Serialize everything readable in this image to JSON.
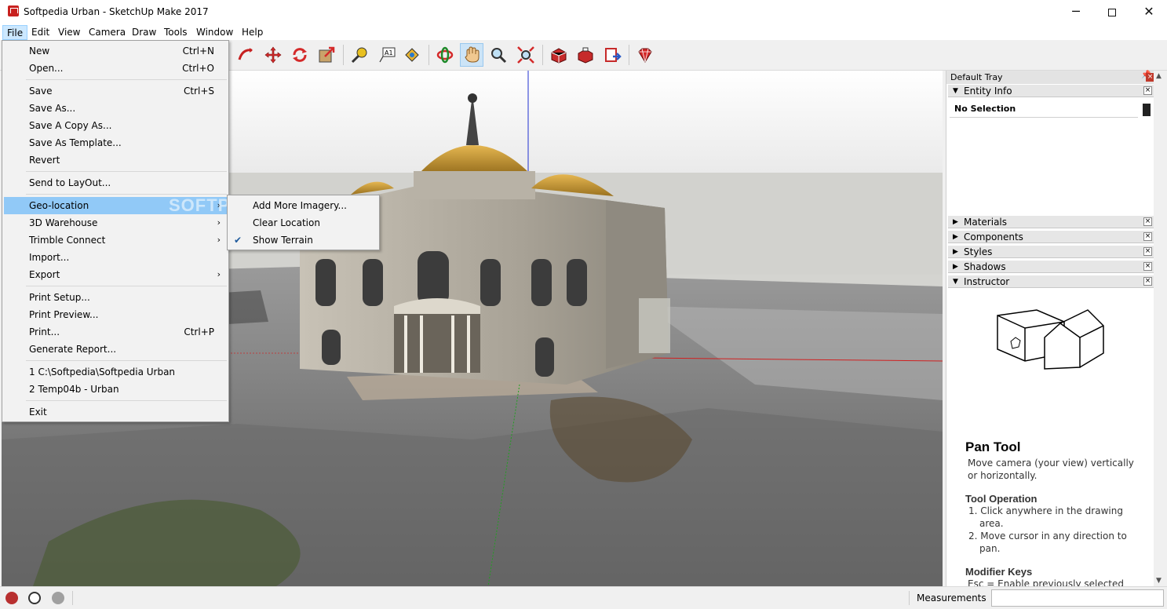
{
  "window": {
    "title": "Softpedia Urban - SketchUp Make 2017",
    "min_glyph": "─",
    "close_glyph": "✕"
  },
  "menubar": [
    {
      "label": "File",
      "active": true
    },
    {
      "label": "Edit"
    },
    {
      "label": "View"
    },
    {
      "label": "Camera"
    },
    {
      "label": "Draw"
    },
    {
      "label": "Tools"
    },
    {
      "label": "Window"
    },
    {
      "label": "Help"
    }
  ],
  "toolbar": {
    "icons": [
      "follow-me-icon",
      "move-icon",
      "rotate-icon",
      "scale-icon",
      "tape-measure-icon",
      "text-icon",
      "paint-bucket-icon",
      "orbit-icon",
      "pan-icon",
      "zoom-icon",
      "zoom-extents-icon",
      "3d-warehouse-icon",
      "share-model-icon",
      "send-to-layout-icon",
      "extension-warehouse-icon"
    ],
    "selected": "pan-icon",
    "text_tool_label": "A1"
  },
  "file_menu": {
    "items": [
      {
        "label": "New",
        "shortcut": "Ctrl+N"
      },
      {
        "label": "Open...",
        "shortcut": "Ctrl+O"
      },
      {
        "label": "Save",
        "shortcut": "Ctrl+S"
      },
      {
        "label": "Save As...",
        "shortcut": ""
      },
      {
        "label": "Save A Copy As...",
        "shortcut": ""
      },
      {
        "label": "Save As Template...",
        "shortcut": ""
      },
      {
        "label": "Revert",
        "shortcut": ""
      },
      {
        "label": "Send to LayOut...",
        "shortcut": ""
      },
      {
        "label": "Geo-location",
        "submenu": true,
        "highlighted": true
      },
      {
        "label": "3D Warehouse",
        "submenu": true
      },
      {
        "label": "Trimble Connect",
        "submenu": true
      },
      {
        "label": "Import...",
        "shortcut": ""
      },
      {
        "label": "Export",
        "submenu": true
      },
      {
        "label": "Print Setup...",
        "shortcut": ""
      },
      {
        "label": "Print Preview...",
        "shortcut": ""
      },
      {
        "label": "Print...",
        "shortcut": "Ctrl+P"
      },
      {
        "label": "Generate Report...",
        "shortcut": ""
      },
      {
        "label": "1 C:\\Softpedia\\Softpedia Urban",
        "shortcut": ""
      },
      {
        "label": "2 Temp04b - Urban",
        "shortcut": ""
      },
      {
        "label": "Exit",
        "shortcut": ""
      }
    ]
  },
  "geo_submenu": {
    "items": [
      {
        "label": "Add More Imagery...",
        "checked": false
      },
      {
        "label": "Clear Location",
        "checked": false
      },
      {
        "label": "Show Terrain",
        "checked": true
      }
    ]
  },
  "watermark": "SOFTPEDIA",
  "tray": {
    "title": "Default Tray",
    "panels": {
      "entity_info": "Entity Info",
      "no_selection": "No Selection",
      "materials": "Materials",
      "components": "Components",
      "styles": "Styles",
      "shadows": "Shadows",
      "instructor": "Instructor"
    },
    "instructor": {
      "title": "Pan Tool",
      "desc": "Move camera (your view) vertically or horizontally.",
      "op_heading": "Tool Operation",
      "op1": "1. Click anywhere in the drawing area.",
      "op2": "2. Move cursor in any direction to pan.",
      "mod_heading": "Modifier Keys",
      "mod1": "Esc = Enable previously selected"
    }
  },
  "statusbar": {
    "measurements_label": "Measurements",
    "measurements_value": ""
  },
  "colors": {
    "menu_highlight": "#91c9f7",
    "selected_tool": "#cce4f7",
    "axis_red": "#d02020",
    "axis_blue": "#2030d0",
    "axis_green": "#20a020"
  }
}
